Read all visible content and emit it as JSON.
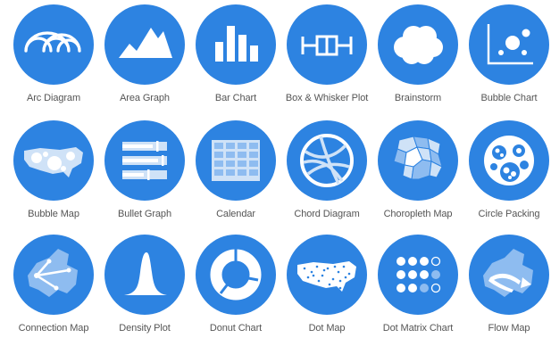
{
  "colors": {
    "accent": "#2d83e1",
    "light": "#ffffff",
    "pale": "#cfe2f7",
    "mid": "#8ebcf0",
    "label": "#555555"
  },
  "tiles": [
    {
      "label": "Arc Diagram",
      "icon": "arc-diagram-icon"
    },
    {
      "label": "Area Graph",
      "icon": "area-graph-icon"
    },
    {
      "label": "Bar Chart",
      "icon": "bar-chart-icon"
    },
    {
      "label": "Box & Whisker Plot",
      "icon": "box-whisker-icon"
    },
    {
      "label": "Brainstorm",
      "icon": "brainstorm-cloud-icon"
    },
    {
      "label": "Bubble Chart",
      "icon": "bubble-chart-icon"
    },
    {
      "label": "Bubble Map",
      "icon": "bubble-map-icon"
    },
    {
      "label": "Bullet Graph",
      "icon": "bullet-graph-icon"
    },
    {
      "label": "Calendar",
      "icon": "calendar-icon"
    },
    {
      "label": "Chord Diagram",
      "icon": "chord-diagram-icon"
    },
    {
      "label": "Choropleth Map",
      "icon": "choropleth-map-icon"
    },
    {
      "label": "Circle Packing",
      "icon": "circle-packing-icon"
    },
    {
      "label": "Connection Map",
      "icon": "connection-map-icon"
    },
    {
      "label": "Density Plot",
      "icon": "density-plot-icon"
    },
    {
      "label": "Donut Chart",
      "icon": "donut-chart-icon"
    },
    {
      "label": "Dot Map",
      "icon": "dot-map-icon"
    },
    {
      "label": "Dot Matrix Chart",
      "icon": "dot-matrix-icon"
    },
    {
      "label": "Flow Map",
      "icon": "flow-map-icon"
    }
  ]
}
